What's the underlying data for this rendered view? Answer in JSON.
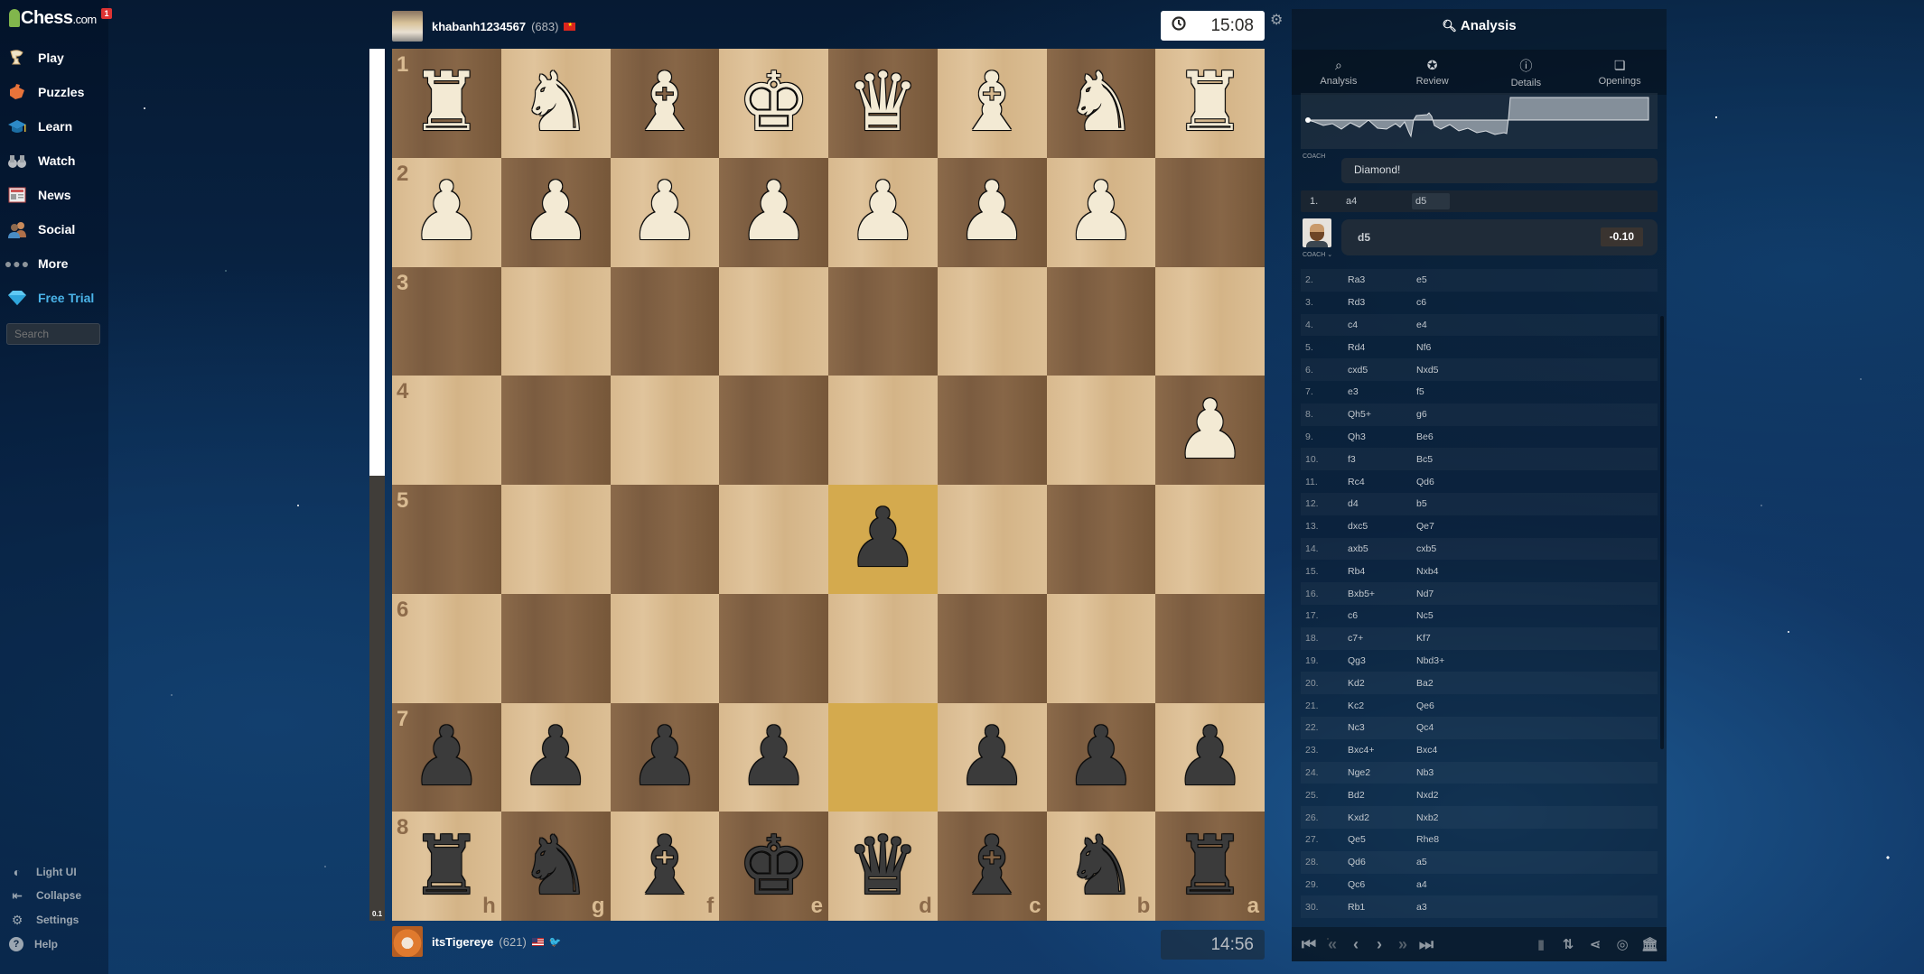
{
  "sidebar": {
    "logo_text": "Chess",
    "logo_suffix": ".com",
    "notification_count": "1",
    "items": [
      {
        "label": "Play",
        "icon": "play-icon"
      },
      {
        "label": "Puzzles",
        "icon": "puzzle-icon"
      },
      {
        "label": "Learn",
        "icon": "learn-icon"
      },
      {
        "label": "Watch",
        "icon": "binoculars-icon"
      },
      {
        "label": "News",
        "icon": "newspaper-icon"
      },
      {
        "label": "Social",
        "icon": "people-icon"
      },
      {
        "label": "More",
        "icon": "ellipsis-icon"
      },
      {
        "label": "Free Trial",
        "icon": "diamond-icon"
      }
    ],
    "search_placeholder": "Search",
    "footer": [
      {
        "label": "Light UI",
        "icon": "theme-icon"
      },
      {
        "label": "Collapse",
        "icon": "collapse-icon"
      },
      {
        "label": "Settings",
        "icon": "gear-icon"
      },
      {
        "label": "Help",
        "icon": "help-icon"
      }
    ]
  },
  "players": {
    "top": {
      "name": "khabanh1234567",
      "rating": "(683)",
      "country": "Vietnam",
      "clock": "15:08"
    },
    "bottom": {
      "name": "itsTigereye",
      "rating": "(621)",
      "country": "United States",
      "clock": "14:56"
    }
  },
  "eval_bar": {
    "score": "0.1",
    "white_fraction": 0.49
  },
  "board": {
    "orientation": "black",
    "rank_labels": [
      "1",
      "2",
      "3",
      "4",
      "5",
      "6",
      "7",
      "8"
    ],
    "file_labels": [
      "h",
      "g",
      "f",
      "e",
      "d",
      "c",
      "b",
      "a"
    ],
    "highlighted_squares": [
      "d7",
      "d5"
    ],
    "colors": {
      "highlight": "#d4aa4e"
    },
    "position": {
      "a1": "wR",
      "b1": "wN",
      "c1": "wB",
      "d1": "wQ",
      "e1": "wK",
      "f1": "wB",
      "g1": "wN",
      "h1": "wR",
      "b2": "wP",
      "c2": "wP",
      "d2": "wP",
      "e2": "wP",
      "f2": "wP",
      "g2": "wP",
      "h2": "wP",
      "a4": "wP",
      "d5": "bP",
      "a7": "bP",
      "b7": "bP",
      "c7": "bP",
      "e7": "bP",
      "f7": "bP",
      "g7": "bP",
      "h7": "bP",
      "a8": "bR",
      "b8": "bN",
      "c8": "bB",
      "d8": "bQ",
      "e8": "bK",
      "f8": "bB",
      "g8": "bN",
      "h8": "bR"
    }
  },
  "analysis": {
    "title": "Analysis",
    "tabs": [
      {
        "label": "Analysis",
        "icon": "magnifier-icon"
      },
      {
        "label": "Review",
        "icon": "star-icon"
      },
      {
        "label": "Details",
        "icon": "info-icon"
      },
      {
        "label": "Openings",
        "icon": "book-icon"
      }
    ],
    "coach_label": "COACH",
    "coach_message": "Diamond!",
    "current_move": {
      "number": "1.",
      "white": "a4",
      "black": "d5"
    },
    "coach_move": "d5",
    "coach_eval": "-0.10",
    "moves": [
      [
        "2.",
        "Ra3",
        "e5"
      ],
      [
        "3.",
        "Rd3",
        "c6"
      ],
      [
        "4.",
        "c4",
        "e4"
      ],
      [
        "5.",
        "Rd4",
        "Nf6"
      ],
      [
        "6.",
        "cxd5",
        "Nxd5"
      ],
      [
        "7.",
        "e3",
        "f5"
      ],
      [
        "8.",
        "Qh5+",
        "g6"
      ],
      [
        "9.",
        "Qh3",
        "Be6"
      ],
      [
        "10.",
        "f3",
        "Bc5"
      ],
      [
        "11.",
        "Rc4",
        "Qd6"
      ],
      [
        "12.",
        "d4",
        "b5"
      ],
      [
        "13.",
        "dxc5",
        "Qe7"
      ],
      [
        "14.",
        "axb5",
        "cxb5"
      ],
      [
        "15.",
        "Rb4",
        "Nxb4"
      ],
      [
        "16.",
        "Bxb5+",
        "Nd7"
      ],
      [
        "17.",
        "c6",
        "Nc5"
      ],
      [
        "18.",
        "c7+",
        "Kf7"
      ],
      [
        "19.",
        "Qg3",
        "Nbd3+"
      ],
      [
        "20.",
        "Kd2",
        "Ba2"
      ],
      [
        "21.",
        "Kc2",
        "Qe6"
      ],
      [
        "22.",
        "Nc3",
        "Qc4"
      ],
      [
        "23.",
        "Bxc4+",
        "Bxc4"
      ],
      [
        "24.",
        "Nge2",
        "Nb3"
      ],
      [
        "25.",
        "Bd2",
        "Nxd2"
      ],
      [
        "26.",
        "Kxd2",
        "Nxb2"
      ],
      [
        "27.",
        "Qe5",
        "Rhe8"
      ],
      [
        "28.",
        "Qd6",
        "a5"
      ],
      [
        "29.",
        "Qc6",
        "a4"
      ],
      [
        "30.",
        "Rb1",
        "a3"
      ]
    ]
  },
  "controls": {
    "nav": [
      "first-move",
      "previous-variation",
      "previous-move",
      "next-move",
      "next-variation",
      "last-move"
    ],
    "tools": [
      "chart-icon",
      "flip-board-icon",
      "share-icon",
      "target-icon",
      "save-to-library-icon"
    ]
  }
}
